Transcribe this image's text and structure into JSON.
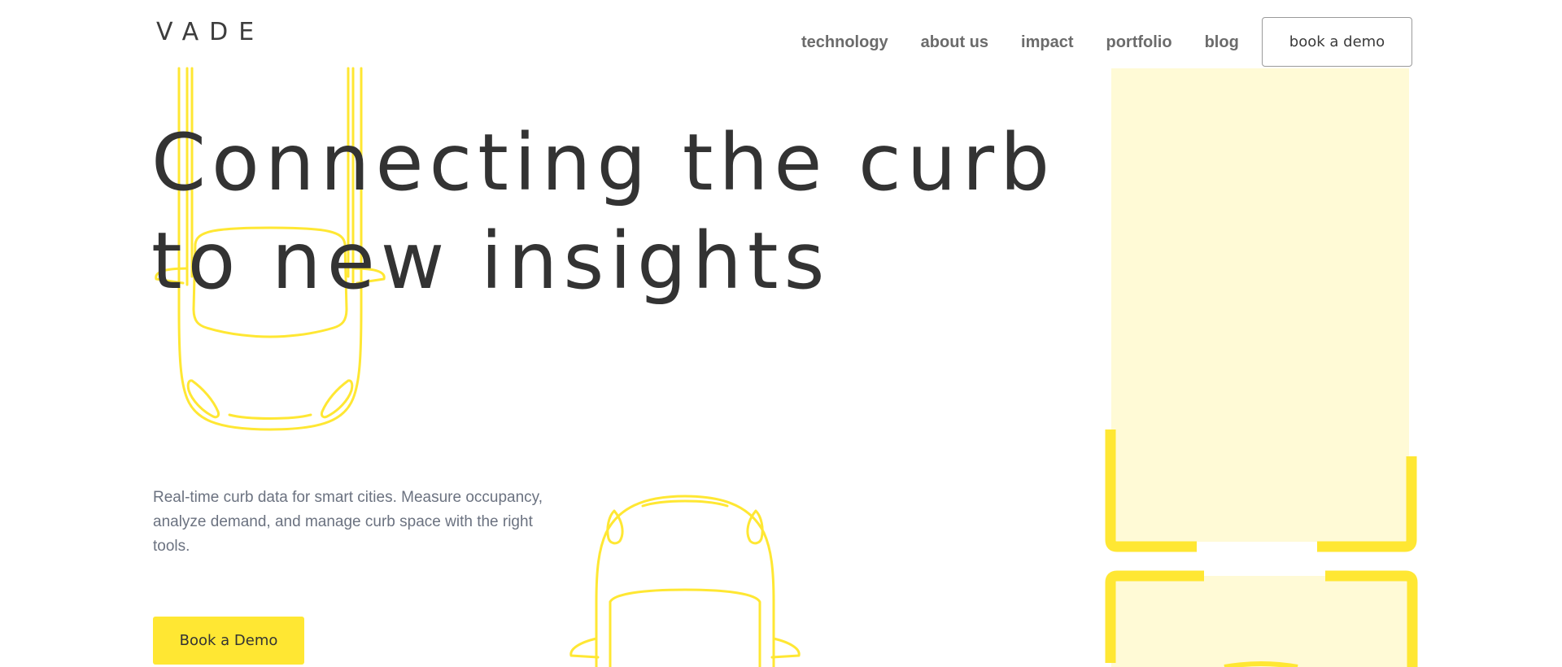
{
  "header": {
    "logo": "VADE",
    "nav": [
      "technology",
      "about us",
      "impact",
      "portfolio",
      "blog"
    ],
    "demo_button": "book a demo"
  },
  "hero": {
    "headline_line1": "Connecting the curb",
    "headline_line2": "to new insights",
    "subtext": "Real-time curb data for smart cities. Measure occupancy, analyze demand, and manage curb space with the right tools.",
    "cta": "Book a Demo"
  },
  "colors": {
    "accent_yellow": "#ffe733",
    "pale_yellow": "#fffad6",
    "text_dark": "#333333",
    "text_muted": "#6b7280"
  }
}
